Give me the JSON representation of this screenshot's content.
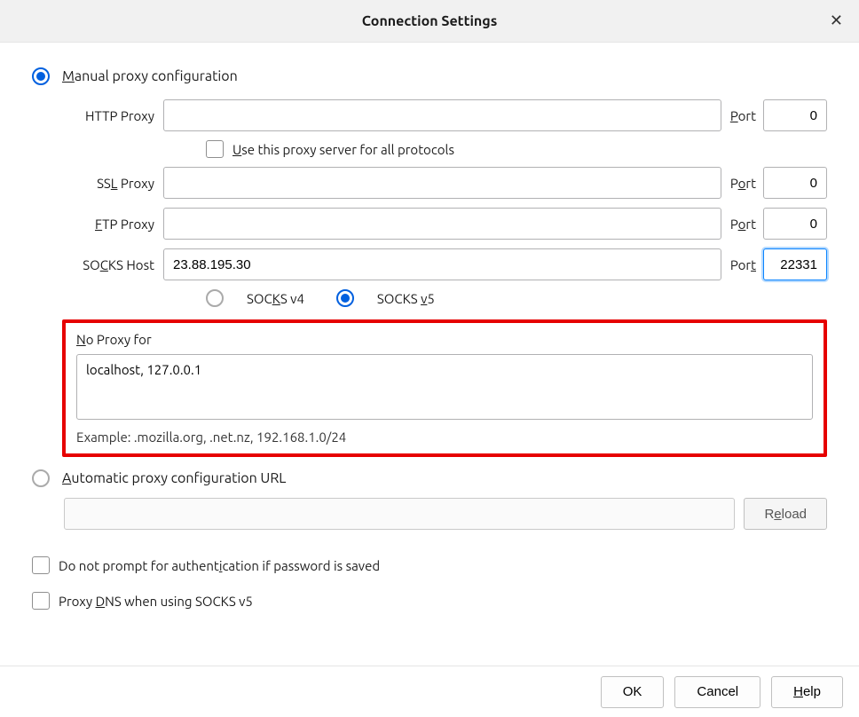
{
  "title": "Connection Settings",
  "manual": {
    "label_pre": "M",
    "label_rest": "anual proxy configuration",
    "http_label": "HTTP Proxy",
    "http_value": "",
    "port_label_pre": "P",
    "port_label_rest": "ort",
    "http_port": "0",
    "use_all_pre": "U",
    "use_all_rest": "se this proxy server for all protocols",
    "ssl_label_pre": "SS",
    "ssl_label_u": "L",
    "ssl_label_rest": " Proxy",
    "ssl_value": "",
    "ssl_port_pre": "P",
    "ssl_port_u": "o",
    "ssl_port_rest": "rt",
    "ssl_port": "0",
    "ftp_label_u": "F",
    "ftp_label_rest": "TP Proxy",
    "ftp_value": "",
    "ftp_port": "0",
    "socks_label_pre": "SO",
    "socks_label_u": "C",
    "socks_label_rest": "KS Host",
    "socks_value": "23.88.195.30",
    "socks_port_pre": "Por",
    "socks_port_u": "t",
    "socks_port": "22331",
    "socks_v4_pre": "SOC",
    "socks_v4_u": "K",
    "socks_v4_rest": "S v4",
    "socks_v5_pre": "SOCKS ",
    "socks_v5_u": "v",
    "socks_v5_rest": "5"
  },
  "noproxy": {
    "title_u": "N",
    "title_rest": "o Proxy for",
    "value": "localhost, 127.0.0.1",
    "example": "Example: .mozilla.org, .net.nz, 192.168.1.0/24"
  },
  "auto": {
    "label_u": "A",
    "label_rest": "utomatic proxy configuration URL",
    "reload_pre": "R",
    "reload_u": "e",
    "reload_rest": "load"
  },
  "checks": {
    "noprompt_pre": "Do not prompt for authent",
    "noprompt_u": "i",
    "noprompt_rest": "cation if password is saved",
    "proxydns_pre": "Proxy ",
    "proxydns_u": "D",
    "proxydns_rest": "NS when using SOCKS v5"
  },
  "footer": {
    "ok": "OK",
    "cancel": "Cancel",
    "help_u": "H",
    "help_rest": "elp"
  }
}
